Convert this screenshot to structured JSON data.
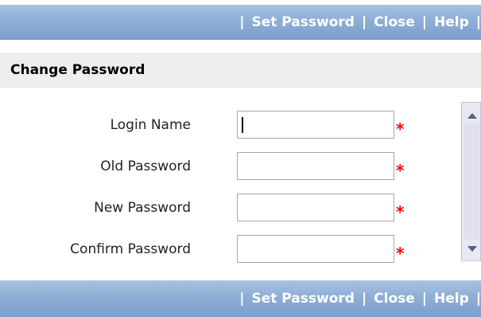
{
  "toolbar": {
    "separator": "|",
    "set_password_label": "Set Password",
    "close_label": "Close",
    "help_label": "Help"
  },
  "section": {
    "title": "Change Password"
  },
  "form": {
    "fields": [
      {
        "label": "Login Name",
        "value": "",
        "required_mark": "*"
      },
      {
        "label": "Old Password",
        "value": "",
        "required_mark": "*"
      },
      {
        "label": "New Password",
        "value": "",
        "required_mark": "*"
      },
      {
        "label": "Confirm Password",
        "value": "",
        "required_mark": "*"
      }
    ]
  },
  "colors": {
    "toolbar_bg": "#8eaed6",
    "header_bg": "#eeeeee",
    "required": "#ff0000"
  }
}
